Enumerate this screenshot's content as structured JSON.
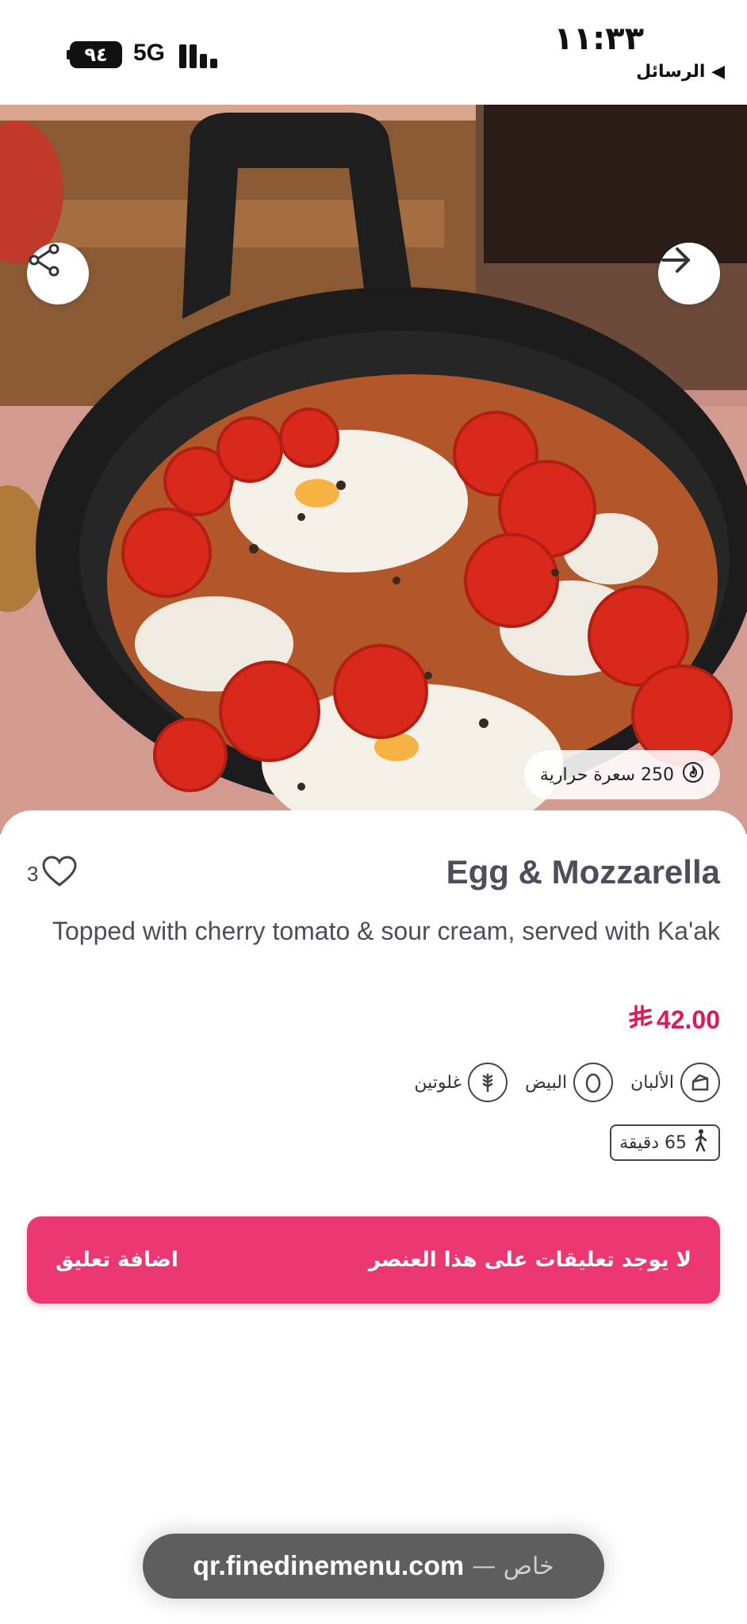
{
  "status_bar": {
    "battery": "٩٤",
    "network": "5G",
    "time": "١١:٣٣",
    "back_app": "◀ الرسائل"
  },
  "hero": {
    "share_icon": "share-icon",
    "forward_icon": "arrow-right-icon",
    "calories": "250 سعرة حرارية"
  },
  "item": {
    "likes": "3",
    "title": "Egg & Mozzarella",
    "description": "Topped with cherry tomato & sour cream, served with Ka'ak",
    "price": "42.00",
    "currency_icon": "riyal-icon",
    "allergens": [
      {
        "label": "الألبان",
        "icon": "dairy-icon"
      },
      {
        "label": "البيض",
        "icon": "egg-icon"
      },
      {
        "label": "غلوتين",
        "icon": "wheat-icon"
      }
    ],
    "prep_time": "65 دقيقة"
  },
  "comments": {
    "empty_text": "لا يوجد تعليقات على هذا العنصر",
    "add_label": "اضافة تعليق"
  },
  "browser": {
    "url": "qr.finedinemenu.com",
    "suffix": "— خاص"
  },
  "colors": {
    "accent": "#ec3770",
    "price": "#d81b5c",
    "text": "#4e4e5a"
  }
}
